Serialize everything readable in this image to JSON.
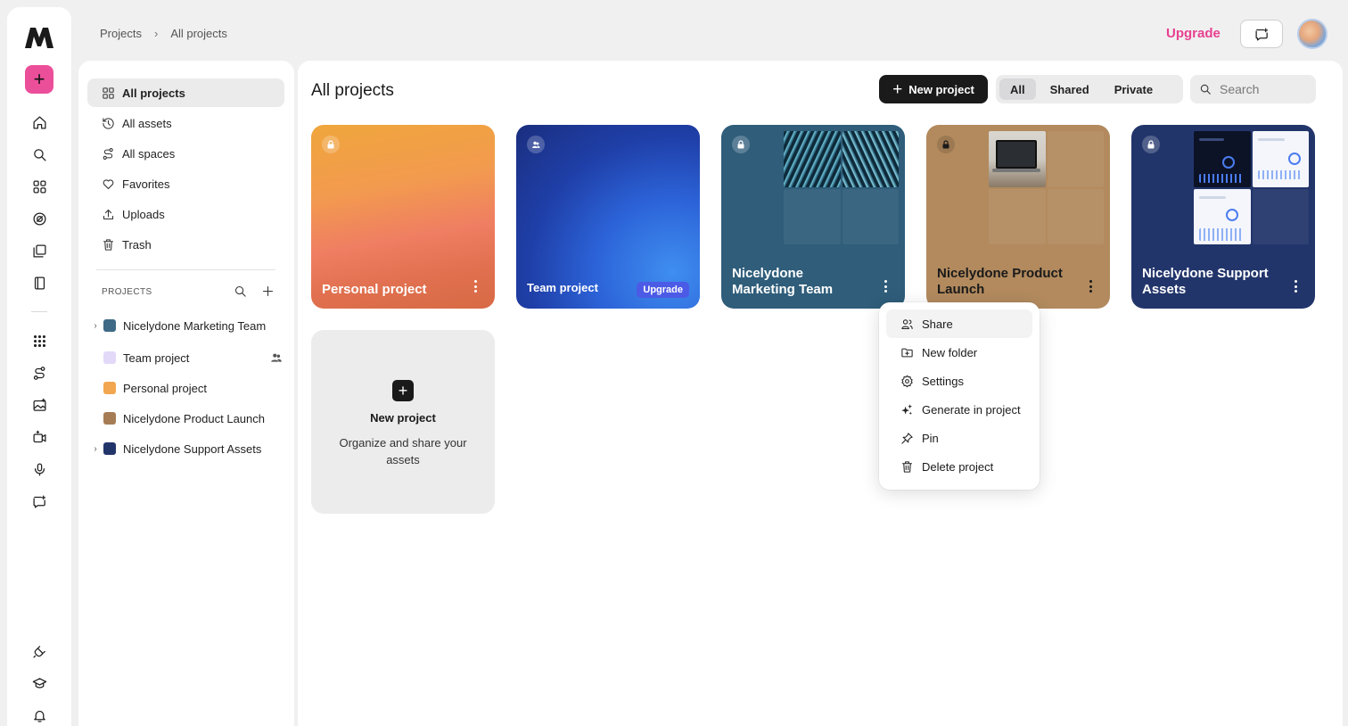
{
  "breadcrumb": {
    "root": "Projects",
    "current": "All projects"
  },
  "header": {
    "upgrade_label": "Upgrade"
  },
  "colors": {
    "accent": "#ec4f9a",
    "upgrade": "#e8418f",
    "badge": "#4c5be6"
  },
  "rail": {
    "icons": [
      "logo-icon",
      "create-plus-icon",
      "home-icon",
      "search-icon",
      "apps-grid-icon",
      "explore-icon",
      "library-icon",
      "book-icon",
      "apps-dots-icon",
      "spaces-icon",
      "image-gen-icon",
      "video-gen-icon",
      "mic-icon",
      "feedback-icon",
      "plugin-icon",
      "learn-icon",
      "bell-icon"
    ]
  },
  "sidebar": {
    "items": [
      {
        "label": "All projects",
        "icon": "grid-icon"
      },
      {
        "label": "All assets",
        "icon": "history-icon"
      },
      {
        "label": "All spaces",
        "icon": "spaces-icon"
      },
      {
        "label": "Favorites",
        "icon": "heart-icon"
      },
      {
        "label": "Uploads",
        "icon": "upload-icon"
      },
      {
        "label": "Trash",
        "icon": "trash-icon"
      }
    ],
    "projects_heading": "PROJECTS",
    "projects": [
      {
        "label": "Nicelydone Marketing Team",
        "color": "#3e6a86"
      },
      {
        "label": "Team project",
        "color": "#e2d8f8"
      },
      {
        "label": "Personal project",
        "color": "#f2a64f"
      },
      {
        "label": "Nicelydone Product Launch",
        "color": "#a67c55"
      },
      {
        "label": "Nicelydone Support Assets",
        "color": "#22356b"
      }
    ]
  },
  "main": {
    "title": "All projects",
    "new_project_label": "New project",
    "filters": [
      "All",
      "Shared",
      "Private"
    ],
    "active_filter": "All",
    "search_placeholder": "Search"
  },
  "cards": [
    {
      "title": "Personal project",
      "visibility": "private"
    },
    {
      "title": "Team project",
      "visibility": "shared",
      "badge": "Upgrade"
    },
    {
      "title": "Nicelydone Marketing Team",
      "visibility": "private"
    },
    {
      "title": "Nicelydone Product Launch",
      "visibility": "private"
    },
    {
      "title": "Nicelydone Support Assets",
      "visibility": "private"
    }
  ],
  "new_card": {
    "title": "New project",
    "description": "Organize and share your assets"
  },
  "context_menu": {
    "items": [
      {
        "label": "Share",
        "icon": "share-icon"
      },
      {
        "label": "New folder",
        "icon": "new-folder-icon"
      },
      {
        "label": "Settings",
        "icon": "settings-icon"
      },
      {
        "label": "Generate in project",
        "icon": "sparkle-icon"
      },
      {
        "label": "Pin",
        "icon": "pin-icon"
      },
      {
        "label": "Delete project",
        "icon": "trash-icon"
      }
    ]
  }
}
